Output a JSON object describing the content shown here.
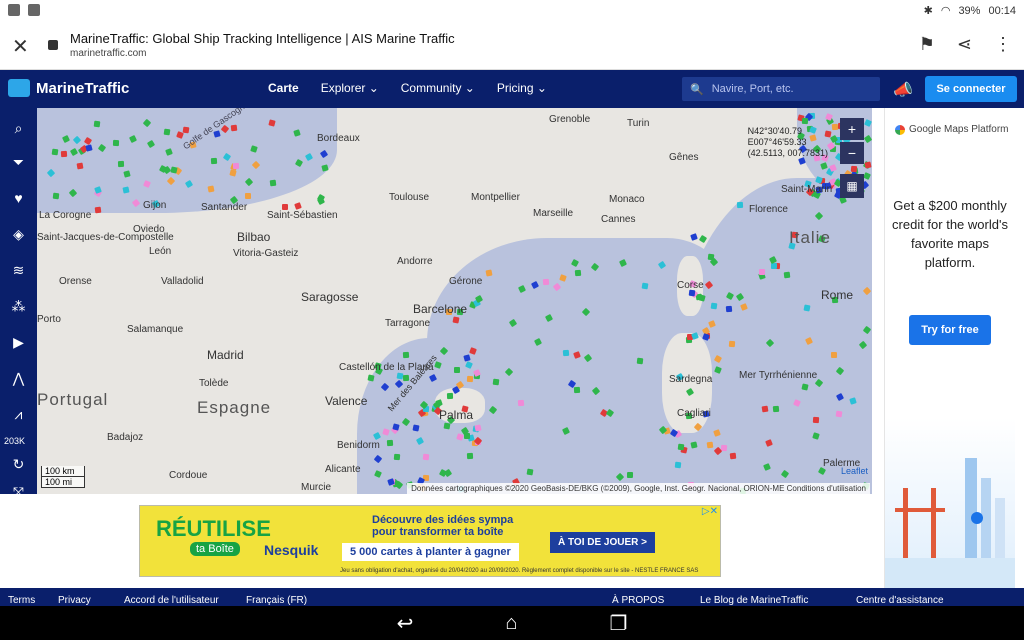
{
  "status_bar": {
    "battery": "39%",
    "time": "00:14"
  },
  "browser": {
    "page_title": "MarineTraffic: Global Ship Tracking Intelligence | AIS Marine Traffic",
    "domain": "marinetraffic.com"
  },
  "header": {
    "brand": "MarineTraffic",
    "nav": [
      {
        "label": "Carte"
      },
      {
        "label": "Explorer"
      },
      {
        "label": "Community"
      },
      {
        "label": "Pricing"
      }
    ],
    "search_placeholder": "Navire, Port, etc.",
    "login_label": "Se connecter"
  },
  "toolbar": {
    "vessel_count": "203K"
  },
  "map": {
    "coords": [
      "N42°30'40.79",
      "E007°46'59.33",
      "(42.5113, 007.7831)"
    ],
    "labels": {
      "grenoble": "Grenoble",
      "turin": "Turin",
      "bordeaux": "Bordeaux",
      "genes": "Gênes",
      "montpellier": "Montpellier",
      "toulouse": "Toulouse",
      "marseille": "Marseille",
      "monaco": "Monaco",
      "cannes": "Cannes",
      "florence": "Florence",
      "saint_marin": "Saint-Marin",
      "gijon": "Gijon",
      "santander": "Santander",
      "saint_sebastien": "Saint-Sébastien",
      "la_corogne": "La Corogne",
      "oviedo": "Oviedo",
      "bilbao": "Bilbao",
      "saint_jacques": "Saint-Jacques-de-Compostelle",
      "italie": "Italie",
      "leon": "León",
      "vitoria": "Vitoria-Gasteiz",
      "andorre": "Andorre",
      "orense": "Orense",
      "valladolid": "Valladolid",
      "saragosse": "Saragosse",
      "gerone": "Gérone",
      "corse": "Corse",
      "rome": "Rome",
      "porto": "Porto",
      "salamanque": "Salamanque",
      "barcelone": "Barcelone",
      "tarragone": "Tarragone",
      "madrid": "Madrid",
      "castellon": "Castellón de la Plana",
      "sardegna": "Sardegna",
      "mer_tyrrhenienne": "Mer Tyrrhénienne",
      "tolede": "Tolède",
      "espagne": "Espagne",
      "portugal": "Portugal",
      "valence": "Valence",
      "palma": "Palma",
      "cagliari": "Cagliari",
      "mer_des_baleares": "Mer des Baléares",
      "badajoz": "Badajoz",
      "benidorm": "Benidorm",
      "cordoue": "Cordoue",
      "alicante": "Alicante",
      "palerme": "Palerme",
      "murcie": "Murcie",
      "golfe_de_gascogne": "Golfe de Gascogne"
    },
    "scale": [
      "100 km",
      "100 mi"
    ],
    "leaflet": "Leaflet",
    "attribution": "Données cartographiques ©2020 GeoBasis-DE/BKG (©2009), Google, Inst. Geogr. Nacional, ORION-ME   Conditions d'utilisation"
  },
  "ad_banner": {
    "brand_main": "RÉUTILISE",
    "brand_sub": "ta Boîte",
    "brand_nestle": "Nesquik",
    "tagline": "Découvre des idées sympa pour transformer ta boîte",
    "offer": "5 000 cartes à planter à gagner",
    "cta": "À TOI DE JOUER >",
    "legal": "Jeu sans obligation d'achat, organisé du 20/04/2020 au 20/09/2020. Règlement complet disponible sur le site - NESTLE FRANCE SAS"
  },
  "right_ad": {
    "brand": "Google Maps Platform",
    "headline": "Get a $200 monthly credit for the world's favorite maps platform.",
    "cta": "Try for free"
  },
  "footer": {
    "items": [
      "Terms",
      "Privacy",
      "Accord de l'utilisateur",
      "Français (FR)",
      "À PROPOS",
      "Le Blog de MarineTraffic",
      "Centre d'assistance"
    ]
  },
  "colors": {
    "header": "#0a1f6b",
    "accent": "#1a8cf0",
    "sea": "#b9c2dd",
    "land": "#e8e6e2"
  }
}
